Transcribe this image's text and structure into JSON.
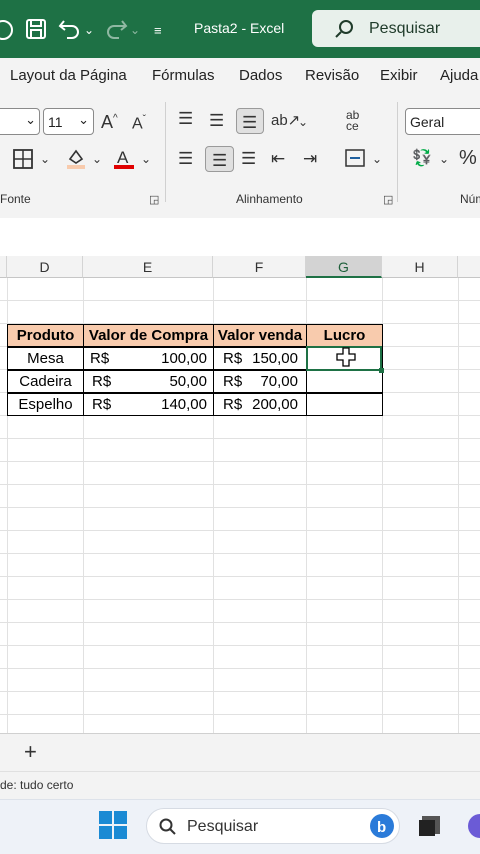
{
  "titlebar": {
    "doc_title": "Pasta2 - Excel",
    "search_label": "Pesquisar",
    "icons": [
      "autosave-toggle-icon",
      "save-icon",
      "undo-icon",
      "redo-icon",
      "customize-qat-icon"
    ]
  },
  "menu": {
    "items": [
      "Layout da Página",
      "Fórmulas",
      "Dados",
      "Revisão",
      "Exibir",
      "Ajuda"
    ]
  },
  "ribbon": {
    "font_size": "11",
    "number_format": "Geral",
    "groups": {
      "fonte": "Fonte",
      "alinhamento": "Alinhamento",
      "numero": "Núm"
    },
    "colors": {
      "font_color": "#e00000",
      "fill_color": "#f8cbad"
    }
  },
  "columns": [
    "D",
    "E",
    "F",
    "G",
    "H"
  ],
  "table": {
    "headers": [
      "Produto",
      "Valor de Compra",
      "Valor venda",
      "Lucro"
    ],
    "currency": "R$",
    "rows": [
      {
        "produto": "Mesa",
        "compra": "100,00",
        "venda": "150,00"
      },
      {
        "produto": "Cadeira",
        "compra": "50,00",
        "venda": "70,00"
      },
      {
        "produto": "Espelho",
        "compra": "140,00",
        "venda": "200,00"
      }
    ],
    "header_fill": "#f8cbad"
  },
  "sheetbar": {
    "add_label": "+"
  },
  "status": {
    "text": "de: tudo certo"
  },
  "taskbar": {
    "search_label": "Pesquisar"
  }
}
